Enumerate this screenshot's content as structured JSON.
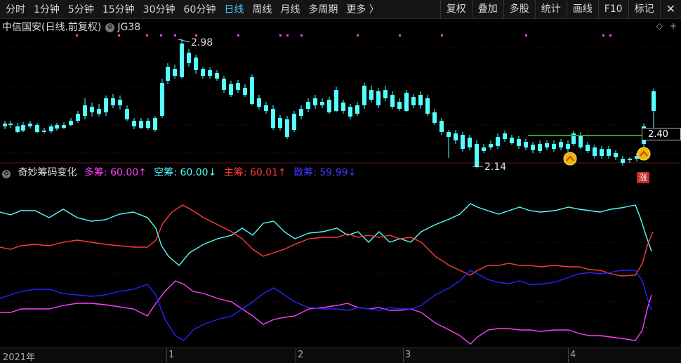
{
  "timeframes": [
    "分时",
    "1分钟",
    "5分钟",
    "15分钟",
    "30分钟",
    "60分钟",
    "日线",
    "周线",
    "月线",
    "多周期",
    "更多 〉"
  ],
  "active_timeframe": "日线",
  "tools": [
    "复权",
    "叠加",
    "多股",
    "统计",
    "画线",
    "F10",
    "标记"
  ],
  "close_glyph": "✕",
  "panel": {
    "stock_name": "中信国安(日线.前复权)",
    "indicator": "JG38"
  },
  "price_annotations": {
    "high": "2.98",
    "low": "2.14",
    "last": "2.40"
  },
  "indicator_panel": {
    "name": "奇妙筹码变化",
    "duochou": "多筹: 60.00↑",
    "kongchou": "空筹: 60.00↓",
    "zhuchou": "主筹: 60.01↑",
    "sanchou": "散筹: 59.99↓"
  },
  "zhang_label": "涨",
  "dates": [
    "2021年",
    "1",
    "2",
    "3",
    "4"
  ],
  "colors": {
    "up": "#ff3b3b",
    "down": "#54ffff",
    "magenta": "#ff40ff",
    "blue": "#2525ff",
    "ma": "#2e9b2e"
  }
}
